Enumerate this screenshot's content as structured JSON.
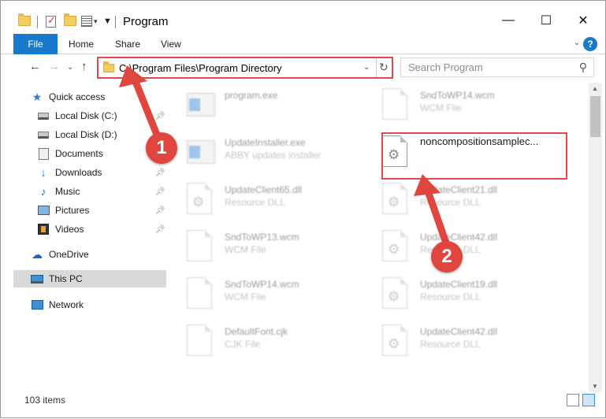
{
  "window": {
    "title": "Program",
    "minimize": "—",
    "maximize": "☐",
    "close": "✕"
  },
  "ribbon": {
    "tabs": [
      "File",
      "Home",
      "Share",
      "View"
    ],
    "help": "?"
  },
  "address": {
    "path": "C:\\Program Files\\Program Directory"
  },
  "search": {
    "placeholder": "Search Program"
  },
  "nav": {
    "items": [
      {
        "label": "Quick access",
        "icon": "star-icon"
      },
      {
        "label": "Local Disk (C:)",
        "icon": "drive-icon",
        "pinned": true
      },
      {
        "label": "Local Disk (D:)",
        "icon": "drive-icon"
      },
      {
        "label": "Documents",
        "icon": "documents-icon"
      },
      {
        "label": "Downloads",
        "icon": "downloads-icon",
        "pinned": true
      },
      {
        "label": "Music",
        "icon": "music-icon",
        "pinned": true
      },
      {
        "label": "Pictures",
        "icon": "pictures-icon",
        "pinned": true
      },
      {
        "label": "Videos",
        "icon": "videos-icon",
        "pinned": true
      },
      {
        "label": "OneDrive",
        "icon": "cloud-icon"
      },
      {
        "label": "This PC",
        "icon": "computer-icon",
        "selected": true
      },
      {
        "label": "Network",
        "icon": "network-icon"
      }
    ]
  },
  "files": [
    {
      "name": "program.exe",
      "type": "",
      "icon": "exe-icon"
    },
    {
      "name": "SndToWP14.wcm",
      "type": "WCM File",
      "icon": "document-icon"
    },
    {
      "name": "UpdateInstaller.exe",
      "type": "ABBY updates installer",
      "icon": "exe-icon"
    },
    {
      "name": "noncompositionsamplec...",
      "type": "",
      "icon": "settings-file-icon"
    },
    {
      "name": "UpdateClient65.dll",
      "type": "Resource DLL",
      "icon": "settings-file-icon"
    },
    {
      "name": "UpdateClient21.dll",
      "type": "Resource DLL",
      "icon": "settings-file-icon"
    },
    {
      "name": "SndToWP13.wcm",
      "type": "WCM File",
      "icon": "document-icon"
    },
    {
      "name": "UpdateClient42.dll",
      "type": "Resource DLL",
      "icon": "settings-file-icon"
    },
    {
      "name": "SndToWP14.wcm",
      "type": "WCM File",
      "icon": "document-icon"
    },
    {
      "name": "UpdateClient19.dll",
      "type": "Resource DLL",
      "icon": "settings-file-icon"
    },
    {
      "name": "DefaultFont.cjk",
      "type": "CJK File",
      "icon": "document-icon"
    },
    {
      "name": "UpdateClient42.dll",
      "type": "Resource DLL",
      "icon": "settings-file-icon"
    }
  ],
  "status": {
    "item_count": "103 items"
  },
  "annotations": {
    "callout_1": "1",
    "callout_2": "2",
    "color": "#e0463d"
  }
}
